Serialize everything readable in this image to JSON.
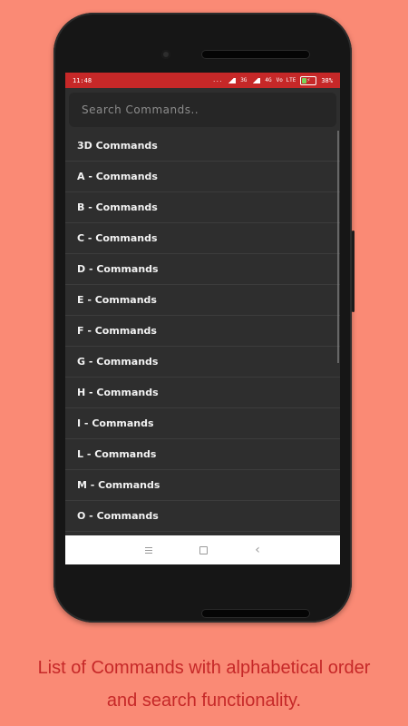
{
  "status_bar": {
    "time": "11:48",
    "dots": "...",
    "net1": "3G",
    "net2": "4G",
    "volte": "Vo LTE",
    "battery": "38%",
    "battery_level": 38
  },
  "search": {
    "placeholder": "Search Commands.."
  },
  "commands": [
    "3D Commands",
    "A - Commands",
    "B - Commands",
    "C - Commands",
    "D - Commands",
    "E - Commands",
    "F - Commands",
    "G - Commands",
    "H - Commands",
    "I - Commands",
    "L - Commands",
    "M - Commands",
    "O - Commands"
  ],
  "nav": {
    "menu_icon": "menu-icon",
    "home_icon": "square-icon",
    "back_icon": "back-icon",
    "back_glyph": "‹"
  },
  "caption": {
    "line1": "List of Commands with alphabetical order",
    "line2": "and search functionality."
  },
  "colors": {
    "background": "#fa8a75",
    "status_bar": "#c62828",
    "list_bg": "#2e2e2e",
    "caption_text": "#c62828"
  }
}
